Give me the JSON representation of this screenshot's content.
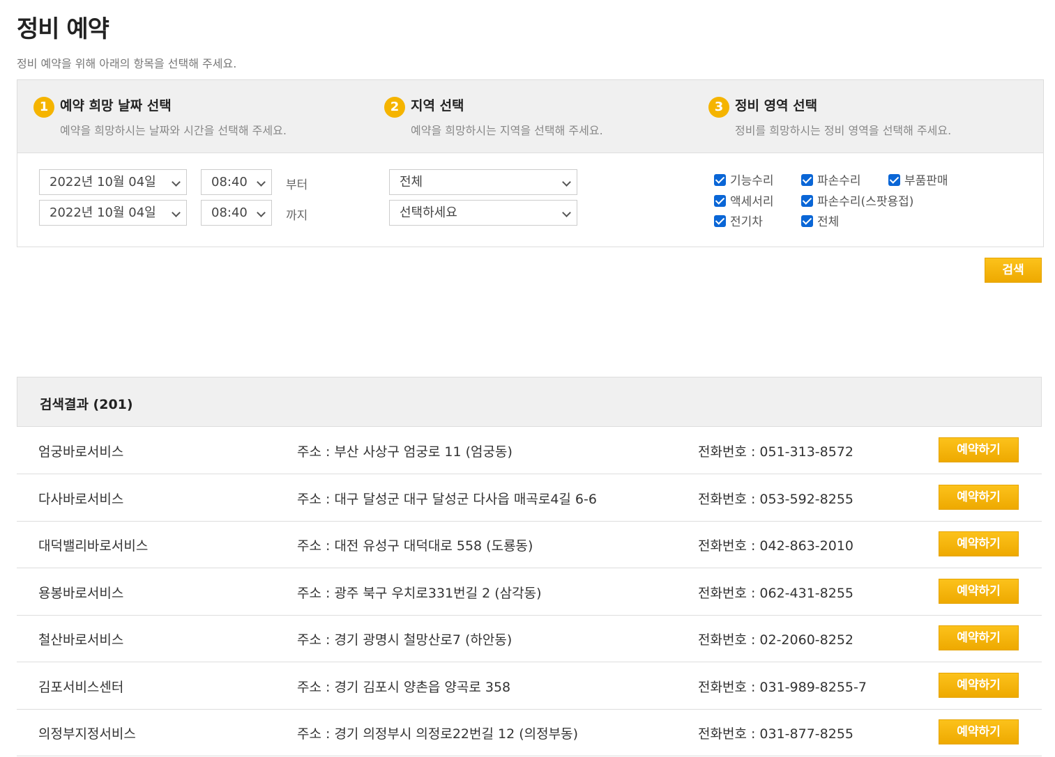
{
  "page": {
    "title": "정비 예약",
    "subtitle": "정비 예약을 위해 아래의 항목을 선택해 주세요."
  },
  "steps": [
    {
      "num": "1",
      "title": "예약 희망 날짜 선택",
      "desc": "예약을 희망하시는 날짜와 시간을 선택해 주세요."
    },
    {
      "num": "2",
      "title": "지역 선택",
      "desc": "예약을 희망하시는 지역을 선택해 주세요."
    },
    {
      "num": "3",
      "title": "정비 영역 선택",
      "desc": "정비를 희망하시는 정비 영역을 선택해 주세요."
    }
  ],
  "date_range": {
    "start_date": "2022년 10월 04일",
    "start_time": "08:40",
    "from_label": "부터",
    "end_date": "2022년 10월 04일",
    "end_time": "08:40",
    "to_label": "까지"
  },
  "region": {
    "province": "전체",
    "district": "선택하세요"
  },
  "service_areas": [
    {
      "label": "기능수리",
      "checked": true
    },
    {
      "label": "파손수리",
      "checked": true
    },
    {
      "label": "부품판매",
      "checked": true
    },
    {
      "label": "액세서리",
      "checked": true
    },
    {
      "label": "파손수리(스팟용접)",
      "checked": true
    },
    {
      "label": "전기차",
      "checked": true
    },
    {
      "label": "전체",
      "checked": true
    }
  ],
  "search_button": "검색",
  "results": {
    "title": "검색결과 (201)",
    "book_label": "예약하기",
    "items": [
      {
        "name": "엄궁바로서비스",
        "address": "주소 : 부산 사상구 엄궁로 11 (엄궁동)",
        "phone": "전화번호 : 051-313-8572"
      },
      {
        "name": "다사바로서비스",
        "address": "주소 : 대구 달성군 대구 달성군 다사읍 매곡로4길 6-6",
        "phone": "전화번호 : 053-592-8255"
      },
      {
        "name": "대덕밸리바로서비스",
        "address": "주소 : 대전 유성구 대덕대로 558 (도룡동)",
        "phone": "전화번호 : 042-863-2010"
      },
      {
        "name": "용봉바로서비스",
        "address": "주소 : 광주 북구 우치로331번길 2 (삼각동)",
        "phone": "전화번호 : 062-431-8255"
      },
      {
        "name": "철산바로서비스",
        "address": "주소 : 경기 광명시 철망산로7 (하안동)",
        "phone": "전화번호 : 02-2060-8252"
      },
      {
        "name": "김포서비스센터",
        "address": "주소 : 경기 김포시 양촌읍 양곡로 358",
        "phone": "전화번호 : 031-989-8255-7"
      },
      {
        "name": "의정부지정서비스",
        "address": "주소 : 경기 의정부시 의정로22번길 12 (의정부동)",
        "phone": "전화번호 : 031-877-8255"
      }
    ]
  },
  "colors": {
    "accent": "#f5b400",
    "checkbox": "#0a66d6",
    "panel_bg": "#f0f0f0"
  }
}
